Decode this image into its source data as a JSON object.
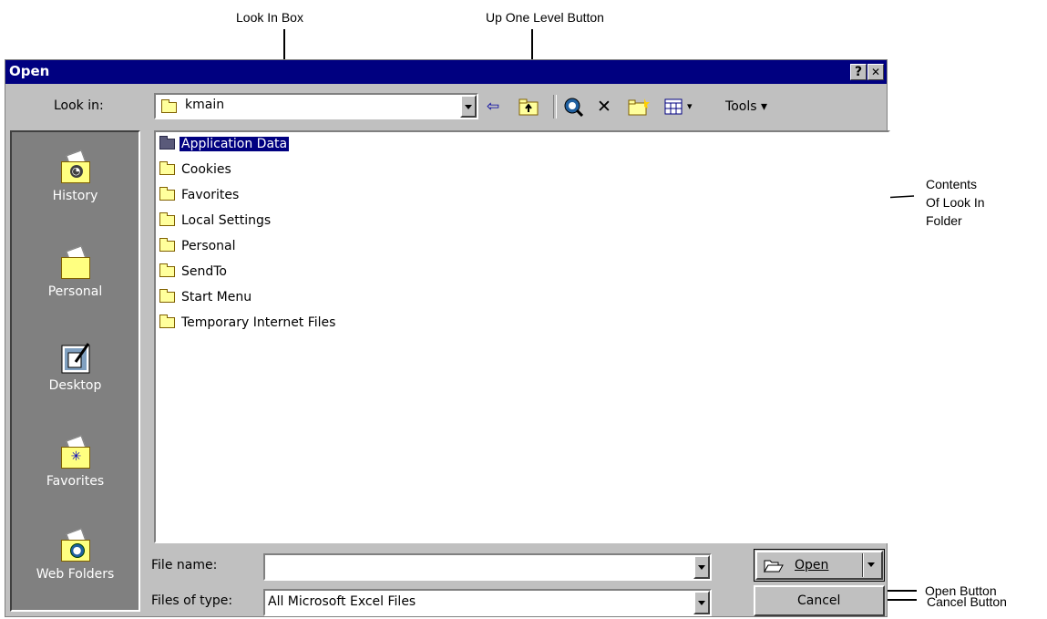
{
  "annotations": {
    "look_in_box": "Look In Box",
    "up_one_level": "Up One Level Button",
    "contents_line1": "Contents",
    "contents_line2": "Of Look In",
    "contents_line3": "Folder",
    "open_button": "Open Button",
    "cancel_button": "Cancel Button"
  },
  "dialog": {
    "title": "Open",
    "help_glyph": "?",
    "close_glyph": "✕"
  },
  "lookin": {
    "label": "Look in:",
    "value": "kmain"
  },
  "toolbar": {
    "back_glyph": "⇦",
    "search_glyph": "◉",
    "delete_glyph": "✕",
    "tools_label": "Tools ▾",
    "views_arrow": "▾"
  },
  "places": [
    {
      "label": "History",
      "icon": "history-icon"
    },
    {
      "label": "Personal",
      "icon": "personal-icon"
    },
    {
      "label": "Desktop",
      "icon": "desktop-icon"
    },
    {
      "label": "Favorites",
      "icon": "favorites-icon"
    },
    {
      "label": "Web Folders",
      "icon": "web-folders-icon"
    }
  ],
  "files": [
    "Application Data",
    "Cookies",
    "Favorites",
    "Local Settings",
    "Personal",
    "SendTo",
    "Start Menu",
    "Temporary Internet Files"
  ],
  "selected_file": "Application Data",
  "filename": {
    "label": "File name:",
    "value": ""
  },
  "filetype": {
    "label": "Files of type:",
    "value": "All Microsoft Excel Files"
  },
  "buttons": {
    "open": "Open",
    "cancel": "Cancel"
  },
  "colors": {
    "titlebar": "#000080",
    "dialog_face": "#c0c0c0",
    "places_bg": "#808080",
    "folder_yellow": "#ffff9c"
  }
}
